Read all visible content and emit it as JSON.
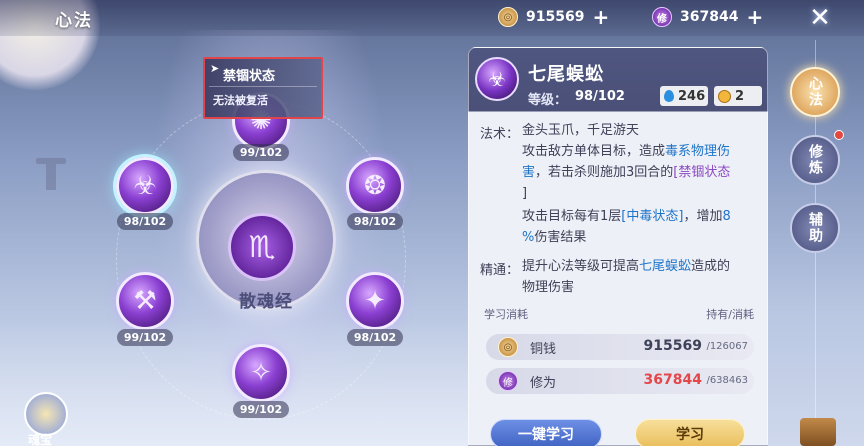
{
  "header": {
    "title": "心法",
    "currency_coin": {
      "icon": "copper-coin-icon",
      "amount": "915569"
    },
    "currency_xiu": {
      "icon": "xiu-badge-icon",
      "label": "修",
      "amount": "367844"
    },
    "close_icon": "close-icon"
  },
  "tooltip": {
    "title": "禁锢状态",
    "desc": "无法被复活"
  },
  "wheel": {
    "core_name": "散魂经",
    "nodes": [
      {
        "level": "99/102"
      },
      {
        "level": "98/102"
      },
      {
        "level": "98/102"
      },
      {
        "level": "99/102"
      },
      {
        "level": "98/102"
      },
      {
        "level": "99/102"
      }
    ]
  },
  "treasure": {
    "label": "魂宝"
  },
  "panel": {
    "skill_name": "七尾蜈蚣",
    "level_label": "等级：",
    "level_value": "98/102",
    "stat_water": "246",
    "stat_time": "2",
    "fashu_label": "法术：",
    "fashu_line1": "金头玉爪，千足游天",
    "fashu_line2a": "攻击敌方单体目标，造成",
    "fashu_line2b": "毒系物理伤",
    "fashu_line3a": "害",
    "fashu_line3b": "，若击杀则施加3回合的",
    "fashu_line3c": "[禁锢状态",
    "fashu_line4": "]",
    "fashu_line5a": "攻击目标每有1层",
    "fashu_line5b": "[中毒状态]",
    "fashu_line5c": "，增加",
    "fashu_line5d": "8",
    "fashu_line6a": "%",
    "fashu_line6b": "伤害结果",
    "jingtong_label": "精通：",
    "jingtong_line1a": "提升心法等级可提高",
    "jingtong_line1b": "七尾蜈蚣",
    "jingtong_line1c": "造成的",
    "jingtong_line2": "物理伤害",
    "cost_header_left": "学习消耗",
    "cost_header_right": "持有/消耗",
    "cost_rows": [
      {
        "name": "铜钱",
        "have": "915569",
        "need": "/126067"
      },
      {
        "name": "修为",
        "have": "367844",
        "need": "/638463"
      }
    ],
    "btn_one_key": "一键学习",
    "btn_learn": "学习"
  },
  "side_tabs": [
    {
      "label": "心法"
    },
    {
      "label": "修炼"
    },
    {
      "label": "辅助"
    }
  ]
}
